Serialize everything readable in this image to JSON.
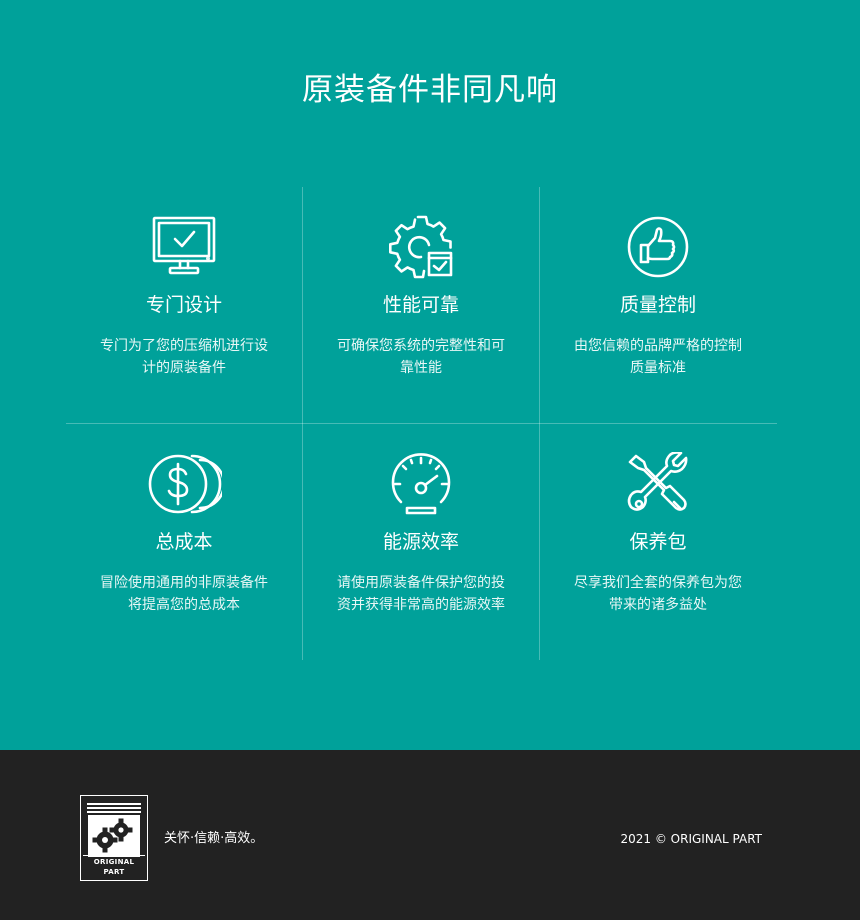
{
  "hero": {
    "title": "原装备件非同凡响",
    "background_color": "#00a19a"
  },
  "features": [
    {
      "icon": "monitor-check-icon",
      "title": "专门设计",
      "desc_line1": "专门为了您的压缩机进行设",
      "desc_line2": "计的原装备件"
    },
    {
      "icon": "gear-check-icon",
      "title": "性能可靠",
      "desc_line1": "可确保您系统的完整性和可",
      "desc_line2": "靠性能"
    },
    {
      "icon": "thumbs-up-icon",
      "title": "质量控制",
      "desc_line1": "由您信赖的品牌严格的控制",
      "desc_line2": "质量标准"
    },
    {
      "icon": "dollar-coin-icon",
      "title": "总成本",
      "desc_line1": "冒险使用通用的非原装备件",
      "desc_line2": "将提高您的总成本"
    },
    {
      "icon": "speedometer-icon",
      "title": "能源效率",
      "desc_line1": "请使用原装备件保护您的投",
      "desc_line2": "资并获得非常高的能源效率"
    },
    {
      "icon": "wrench-screwdriver-icon",
      "title": "保养包",
      "desc_line1": "尽享我们全套的保养包为您",
      "desc_line2": "带来的诸多益处"
    }
  ],
  "footer": {
    "logo_text": "ORIGINAL PART",
    "tagline": "关怀·信赖·高效。",
    "copyright": "2021 © ORIGINAL PART",
    "background_color": "#222222"
  }
}
